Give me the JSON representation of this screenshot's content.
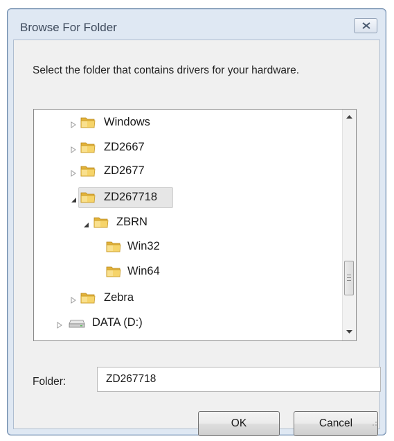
{
  "dialog": {
    "title": "Browse For Folder",
    "instruction": "Select the folder that contains drivers for your hardware.",
    "tree": [
      {
        "label": "Windows",
        "expander": "collapsed",
        "icon": "folder-icon"
      },
      {
        "label": "ZD2667",
        "expander": "collapsed",
        "icon": "folder-icon"
      },
      {
        "label": "ZD2677",
        "expander": "collapsed",
        "icon": "folder-icon"
      },
      {
        "label": "ZD267718",
        "expander": "expanded",
        "icon": "folder-icon",
        "selected": true
      },
      {
        "label": "ZBRN",
        "expander": "expanded",
        "icon": "folder-icon"
      },
      {
        "label": "Win32",
        "expander": "none",
        "icon": "folder-icon"
      },
      {
        "label": "Win64",
        "expander": "none",
        "icon": "folder-icon"
      },
      {
        "label": "Zebra",
        "expander": "collapsed",
        "icon": "folder-icon"
      },
      {
        "label": "DATA (D:)",
        "expander": "collapsed",
        "icon": "drive-icon"
      }
    ],
    "folder_label": "Folder:",
    "folder_value": "ZD267718",
    "ok_label": "OK",
    "cancel_label": "Cancel"
  },
  "colors": {
    "dialog_frame": "#dfe8f3",
    "client_background": "#f0f0f0",
    "folder_yellow": "#f2c94c",
    "selection_highlight": "#e6e6e6"
  }
}
